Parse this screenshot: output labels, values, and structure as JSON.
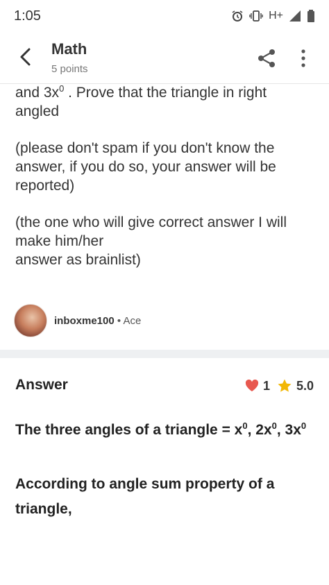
{
  "status": {
    "time": "1:05",
    "network": "H+"
  },
  "header": {
    "title": "Math",
    "subtitle": "5 points"
  },
  "question": {
    "line1_prefix": "and 3x",
    "line1_sup": "0",
    "line1_suffix": " . Prove that the triangle in right angled",
    "para2": "(please don't spam if you don't know the answer, if you do so, your answer will be reported)",
    "para3_line1": "(the one who will give correct answer I will make him/her",
    "para3_line2": "answer as brainlist)"
  },
  "asker": {
    "username": "inboxme100",
    "separator": " • ",
    "rank": "Ace"
  },
  "answer": {
    "label": "Answer",
    "likes": "1",
    "rating": "5.0",
    "line1_a": "The three angles of a triangle = x",
    "sup": "0",
    "line1_b": ", 2x",
    "line1_c": ", 3x",
    "line2": "According to angle sum property of a triangle,"
  },
  "colors": {
    "heart": "#e8584f",
    "star": "#f2b705",
    "divider": "#eef0f2"
  }
}
